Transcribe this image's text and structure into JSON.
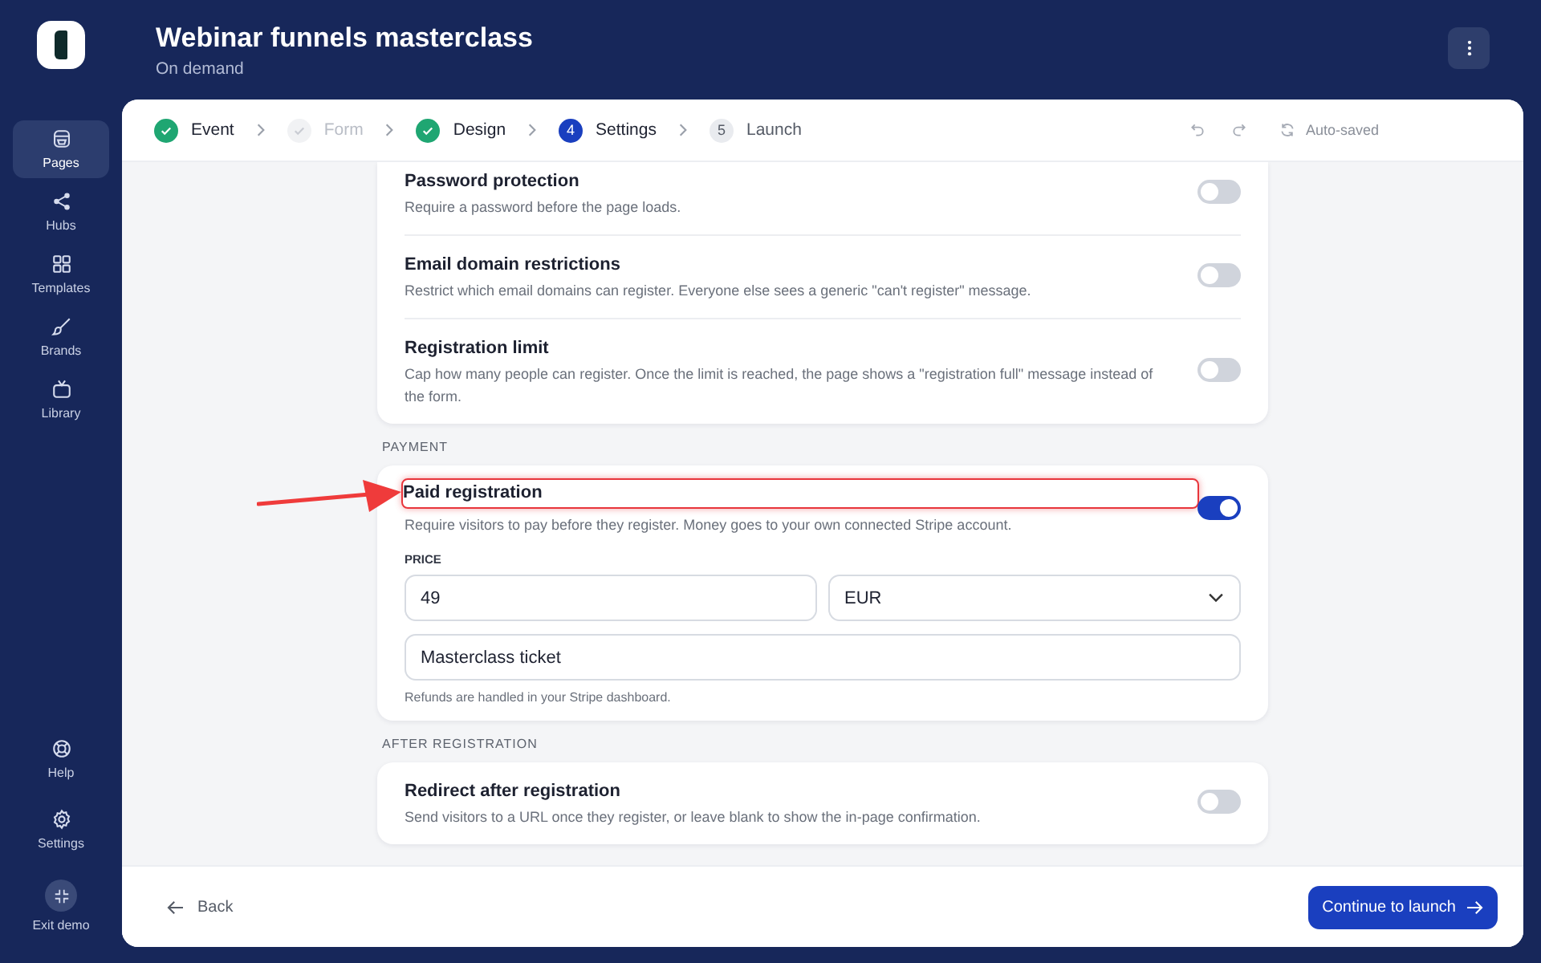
{
  "app": {
    "title": "Webinar funnels masterclass",
    "subtitle": "On demand"
  },
  "sidebar": {
    "items": [
      {
        "label": "Pages",
        "selected": true
      },
      {
        "label": "Hubs",
        "selected": false
      },
      {
        "label": "Templates",
        "selected": false
      },
      {
        "label": "Brands",
        "selected": false
      },
      {
        "label": "Library",
        "selected": false
      }
    ],
    "bottom_items": [
      {
        "label": "Help"
      },
      {
        "label": "Settings"
      },
      {
        "label": "Exit demo"
      }
    ]
  },
  "steps": [
    {
      "label": "Event",
      "kind": "done"
    },
    {
      "label": "Form",
      "kind": "skipped"
    },
    {
      "label": "Design",
      "kind": "done"
    },
    {
      "number": "4",
      "label": "Settings",
      "kind": "current"
    },
    {
      "number": "5",
      "label": "Launch",
      "kind": "upcoming"
    }
  ],
  "save_status": "Auto-saved",
  "sections": [
    {
      "settings": [
        {
          "title": "Password protection",
          "description": "Require a password before the page loads.",
          "on": false,
          "highlighted": false
        },
        {
          "title": "Email domain restrictions",
          "description": "Restrict which email domains can register. Everyone else sees a generic \"can't register\" message.",
          "on": false,
          "highlighted": false
        },
        {
          "title": "Registration limit",
          "description": "Cap how many people can register. Once the limit is reached, the page shows a \"registration full\" message instead of the form.",
          "on": false,
          "highlighted": false
        }
      ]
    },
    {
      "label": "PAYMENT",
      "settings": [
        {
          "title": "Paid registration",
          "description": "Require visitors to pay before they register. Money goes to your own connected Stripe account.",
          "on": true,
          "highlighted": true,
          "price": {
            "label": "PRICE",
            "amount": "49",
            "currency": "EUR",
            "product_name": "Masterclass ticket",
            "note": "Refunds are handled in your Stripe dashboard."
          }
        }
      ]
    },
    {
      "label": "AFTER REGISTRATION",
      "settings": [
        {
          "title": "Redirect after registration",
          "description": "Send visitors to a URL once they register, or leave blank to show the in-page confirmation.",
          "on": false,
          "highlighted": false
        }
      ]
    }
  ],
  "footer": {
    "back": "Back",
    "continue": "Continue to launch"
  }
}
